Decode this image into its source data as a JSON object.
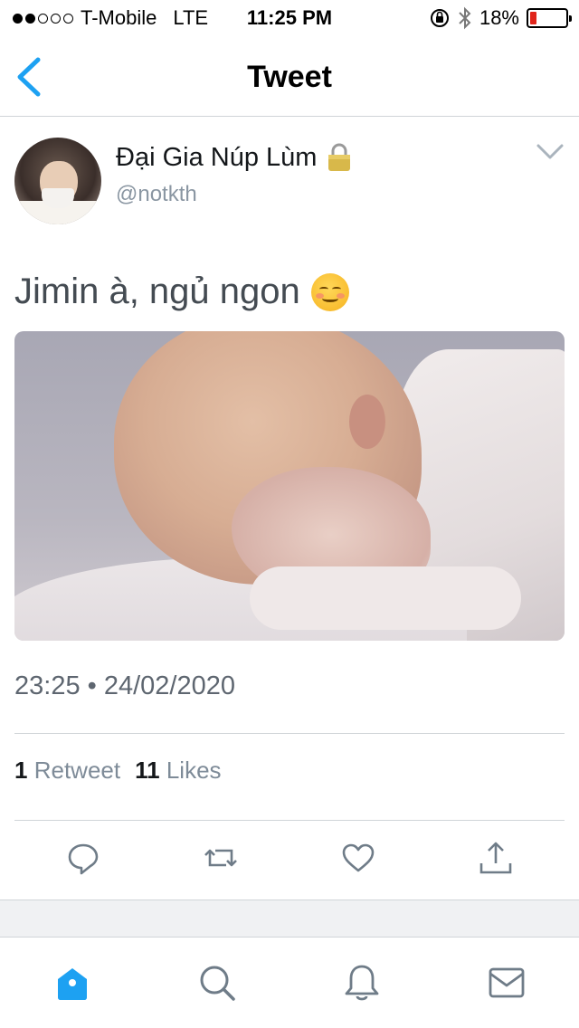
{
  "status_bar": {
    "carrier": "T-Mobile",
    "network": "LTE",
    "time": "11:25 PM",
    "battery_percent": "18%",
    "battery_level": 0.18,
    "signal_bars_filled": 2,
    "signal_bars_total": 5,
    "battery_color": "#e0251b"
  },
  "nav": {
    "title": "Tweet",
    "back_icon": "chevron-left-icon",
    "accent_color": "#1da1f2"
  },
  "tweet": {
    "display_name": "Đại Gia Núp Lùm",
    "handle": "@notkth",
    "text": "Jimin à, ngủ ngon",
    "emoji": "smiling-face-icon",
    "timestamp": "23:25 • 24/02/2020",
    "retweet_count": "1",
    "retweet_label": "Retweet",
    "like_count": "11",
    "like_label": "Likes"
  },
  "actions": [
    "reply-icon",
    "retweet-icon",
    "like-icon",
    "share-icon"
  ],
  "tab_bar": [
    "home-icon",
    "search-icon",
    "notifications-icon",
    "messages-icon"
  ]
}
